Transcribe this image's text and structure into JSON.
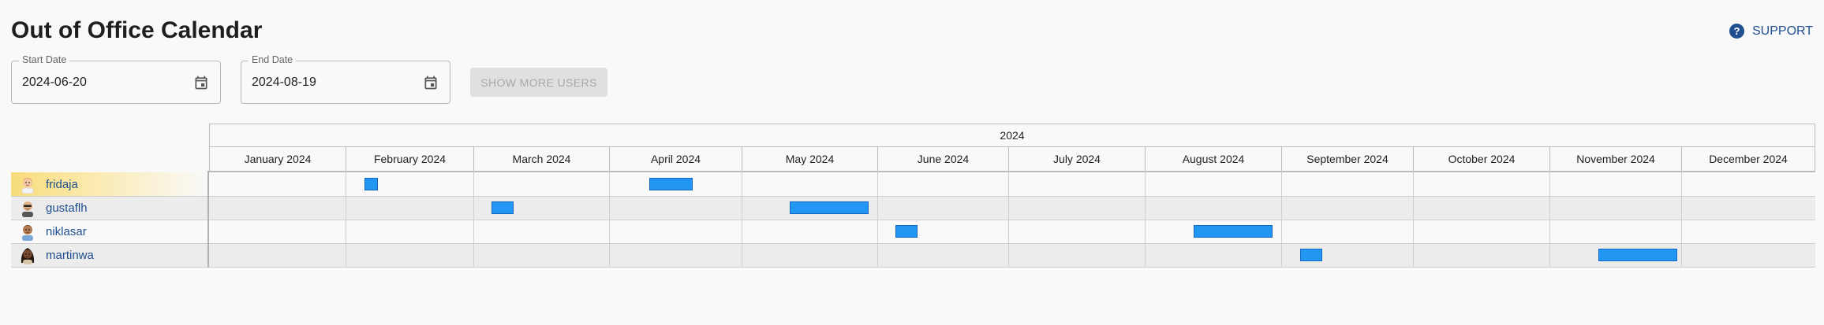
{
  "title": "Out of Office Calendar",
  "support": {
    "label": "SUPPORT",
    "icon": "help-circle-icon"
  },
  "filters": {
    "start": {
      "label": "Start Date",
      "value": "2024-06-20",
      "icon": "calendar-icon"
    },
    "end": {
      "label": "End Date",
      "value": "2024-08-19",
      "icon": "calendar-icon"
    },
    "show_more_label": "SHOW MORE USERS"
  },
  "calendar": {
    "year": "2024",
    "months": [
      "January 2024",
      "February 2024",
      "March 2024",
      "April 2024",
      "May 2024",
      "June 2024",
      "July 2024",
      "August 2024",
      "September 2024",
      "October 2024",
      "November 2024",
      "December 2024"
    ],
    "users": [
      {
        "name": "fridaja",
        "avatar": "avatar-fridaja"
      },
      {
        "name": "gustaflh",
        "avatar": "avatar-gustaflh"
      },
      {
        "name": "niklasar",
        "avatar": "avatar-niklasar"
      },
      {
        "name": "martinwa",
        "avatar": "avatar-martinwa"
      }
    ]
  },
  "colors": {
    "accent": "#2196f3",
    "link": "#1f4f8f",
    "highlight": "#f8dc7c"
  }
}
